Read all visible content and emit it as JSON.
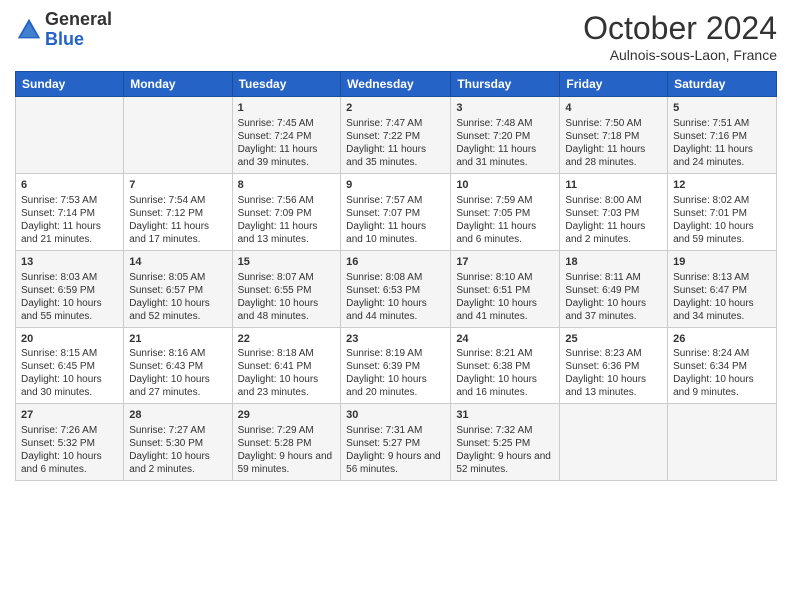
{
  "header": {
    "logo_general": "General",
    "logo_blue": "Blue",
    "month_title": "October 2024",
    "location": "Aulnois-sous-Laon, France"
  },
  "columns": [
    "Sunday",
    "Monday",
    "Tuesday",
    "Wednesday",
    "Thursday",
    "Friday",
    "Saturday"
  ],
  "rows": [
    [
      {
        "num": "",
        "info": ""
      },
      {
        "num": "",
        "info": ""
      },
      {
        "num": "1",
        "info": "Sunrise: 7:45 AM\nSunset: 7:24 PM\nDaylight: 11 hours and 39 minutes."
      },
      {
        "num": "2",
        "info": "Sunrise: 7:47 AM\nSunset: 7:22 PM\nDaylight: 11 hours and 35 minutes."
      },
      {
        "num": "3",
        "info": "Sunrise: 7:48 AM\nSunset: 7:20 PM\nDaylight: 11 hours and 31 minutes."
      },
      {
        "num": "4",
        "info": "Sunrise: 7:50 AM\nSunset: 7:18 PM\nDaylight: 11 hours and 28 minutes."
      },
      {
        "num": "5",
        "info": "Sunrise: 7:51 AM\nSunset: 7:16 PM\nDaylight: 11 hours and 24 minutes."
      }
    ],
    [
      {
        "num": "6",
        "info": "Sunrise: 7:53 AM\nSunset: 7:14 PM\nDaylight: 11 hours and 21 minutes."
      },
      {
        "num": "7",
        "info": "Sunrise: 7:54 AM\nSunset: 7:12 PM\nDaylight: 11 hours and 17 minutes."
      },
      {
        "num": "8",
        "info": "Sunrise: 7:56 AM\nSunset: 7:09 PM\nDaylight: 11 hours and 13 minutes."
      },
      {
        "num": "9",
        "info": "Sunrise: 7:57 AM\nSunset: 7:07 PM\nDaylight: 11 hours and 10 minutes."
      },
      {
        "num": "10",
        "info": "Sunrise: 7:59 AM\nSunset: 7:05 PM\nDaylight: 11 hours and 6 minutes."
      },
      {
        "num": "11",
        "info": "Sunrise: 8:00 AM\nSunset: 7:03 PM\nDaylight: 11 hours and 2 minutes."
      },
      {
        "num": "12",
        "info": "Sunrise: 8:02 AM\nSunset: 7:01 PM\nDaylight: 10 hours and 59 minutes."
      }
    ],
    [
      {
        "num": "13",
        "info": "Sunrise: 8:03 AM\nSunset: 6:59 PM\nDaylight: 10 hours and 55 minutes."
      },
      {
        "num": "14",
        "info": "Sunrise: 8:05 AM\nSunset: 6:57 PM\nDaylight: 10 hours and 52 minutes."
      },
      {
        "num": "15",
        "info": "Sunrise: 8:07 AM\nSunset: 6:55 PM\nDaylight: 10 hours and 48 minutes."
      },
      {
        "num": "16",
        "info": "Sunrise: 8:08 AM\nSunset: 6:53 PM\nDaylight: 10 hours and 44 minutes."
      },
      {
        "num": "17",
        "info": "Sunrise: 8:10 AM\nSunset: 6:51 PM\nDaylight: 10 hours and 41 minutes."
      },
      {
        "num": "18",
        "info": "Sunrise: 8:11 AM\nSunset: 6:49 PM\nDaylight: 10 hours and 37 minutes."
      },
      {
        "num": "19",
        "info": "Sunrise: 8:13 AM\nSunset: 6:47 PM\nDaylight: 10 hours and 34 minutes."
      }
    ],
    [
      {
        "num": "20",
        "info": "Sunrise: 8:15 AM\nSunset: 6:45 PM\nDaylight: 10 hours and 30 minutes."
      },
      {
        "num": "21",
        "info": "Sunrise: 8:16 AM\nSunset: 6:43 PM\nDaylight: 10 hours and 27 minutes."
      },
      {
        "num": "22",
        "info": "Sunrise: 8:18 AM\nSunset: 6:41 PM\nDaylight: 10 hours and 23 minutes."
      },
      {
        "num": "23",
        "info": "Sunrise: 8:19 AM\nSunset: 6:39 PM\nDaylight: 10 hours and 20 minutes."
      },
      {
        "num": "24",
        "info": "Sunrise: 8:21 AM\nSunset: 6:38 PM\nDaylight: 10 hours and 16 minutes."
      },
      {
        "num": "25",
        "info": "Sunrise: 8:23 AM\nSunset: 6:36 PM\nDaylight: 10 hours and 13 minutes."
      },
      {
        "num": "26",
        "info": "Sunrise: 8:24 AM\nSunset: 6:34 PM\nDaylight: 10 hours and 9 minutes."
      }
    ],
    [
      {
        "num": "27",
        "info": "Sunrise: 7:26 AM\nSunset: 5:32 PM\nDaylight: 10 hours and 6 minutes."
      },
      {
        "num": "28",
        "info": "Sunrise: 7:27 AM\nSunset: 5:30 PM\nDaylight: 10 hours and 2 minutes."
      },
      {
        "num": "29",
        "info": "Sunrise: 7:29 AM\nSunset: 5:28 PM\nDaylight: 9 hours and 59 minutes."
      },
      {
        "num": "30",
        "info": "Sunrise: 7:31 AM\nSunset: 5:27 PM\nDaylight: 9 hours and 56 minutes."
      },
      {
        "num": "31",
        "info": "Sunrise: 7:32 AM\nSunset: 5:25 PM\nDaylight: 9 hours and 52 minutes."
      },
      {
        "num": "",
        "info": ""
      },
      {
        "num": "",
        "info": ""
      }
    ]
  ]
}
